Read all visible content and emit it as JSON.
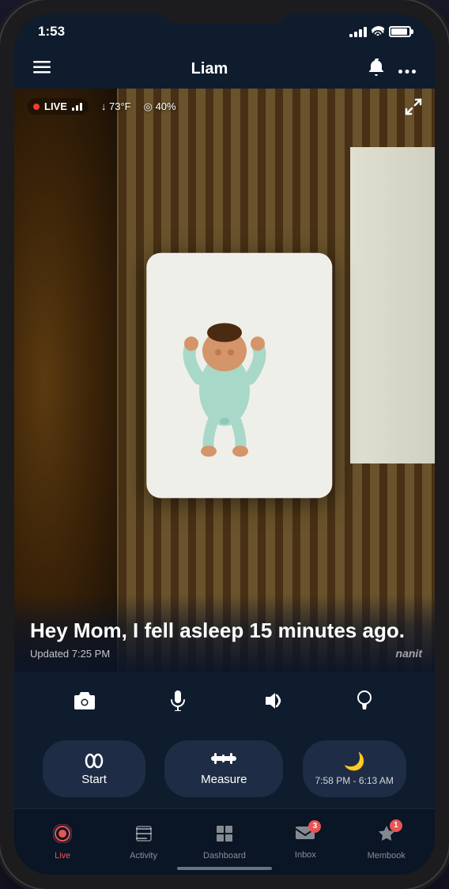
{
  "status_bar": {
    "time": "1:53",
    "battery_full": true
  },
  "header": {
    "title": "Liam",
    "menu_icon": "≡",
    "bell_icon": "🔔",
    "more_icon": "···"
  },
  "camera": {
    "live_label": "LIVE",
    "temperature": "↓ 73°F",
    "humidity": "◎ 40%",
    "sleep_message": "Hey Mom, I fell asleep 15 minutes ago.",
    "updated_text": "Updated 7:25 PM",
    "brand": "nanit"
  },
  "controls": {
    "camera_icon": "📷",
    "mic_icon": "🎤",
    "sound_icon": "((·))",
    "light_icon": "💡"
  },
  "actions": {
    "start_label": "Start",
    "measure_label": "Measure",
    "sleep_time": "7:58 PM - 6:13 AM"
  },
  "nav": {
    "items": [
      {
        "id": "live",
        "label": "Live",
        "active": true,
        "badge": null
      },
      {
        "id": "activity",
        "label": "Activity",
        "active": false,
        "badge": null
      },
      {
        "id": "dashboard",
        "label": "Dashboard",
        "active": false,
        "badge": null
      },
      {
        "id": "inbox",
        "label": "Inbox",
        "active": false,
        "badge": "3"
      },
      {
        "id": "membook",
        "label": "Membook",
        "active": false,
        "badge": "1"
      }
    ]
  }
}
